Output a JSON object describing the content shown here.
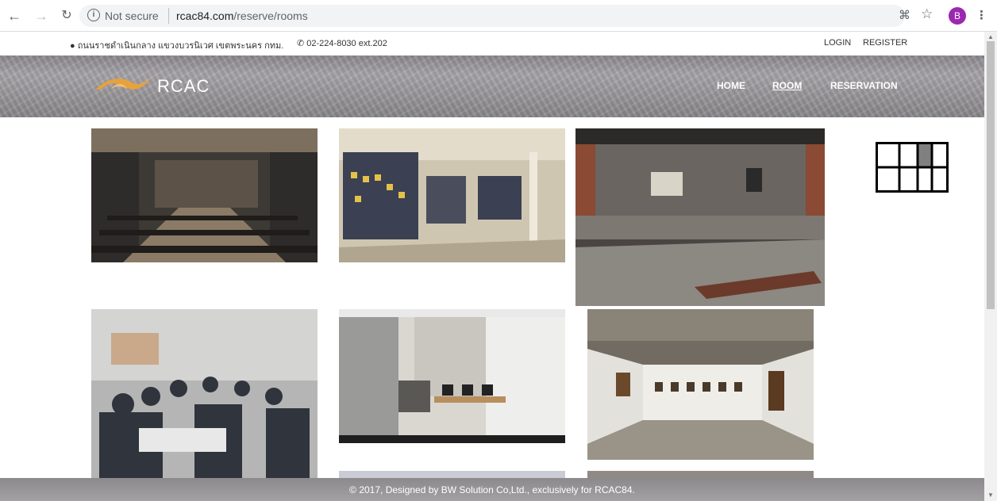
{
  "browser": {
    "security_label": "Not secure",
    "url_host": "rcac84.com",
    "url_path": "/reserve/rooms",
    "avatar_initial": "B"
  },
  "topbar": {
    "address": "ถนนราชดำเนินกลาง แขวงบวรนิเวศ เขตพระนคร กทม.",
    "phone": "02-224-8030 ext.202",
    "login": "LOGIN",
    "register": "REGISTER"
  },
  "header": {
    "brand": "RCAC",
    "menu": [
      {
        "label": "HOME",
        "active": false
      },
      {
        "label": "ROOM",
        "active": true
      },
      {
        "label": "RESERVATION",
        "active": false
      }
    ]
  },
  "gallery": {
    "rooms": [
      {
        "name": "auditorium",
        "colors": [
          "#3d3a35",
          "#8a7a66"
        ]
      },
      {
        "name": "panorama-gallery",
        "colors": [
          "#3b4052",
          "#cfc6b2"
        ]
      },
      {
        "name": "stage-exhibition",
        "colors": [
          "#4a4543",
          "#8c8882"
        ]
      },
      {
        "name": "workshop-room",
        "colors": [
          "#b5b5b5",
          "#30343c"
        ]
      },
      {
        "name": "computer-room",
        "colors": [
          "#9a9a98",
          "#d9d7d0"
        ]
      },
      {
        "name": "white-gallery",
        "colors": [
          "#e3e1dc",
          "#726b61"
        ]
      }
    ]
  },
  "footer": {
    "text": "© 2017, Designed by BW Solution Co,Ltd., exclusively for RCAC84."
  },
  "colors": {
    "header_bg": "#9d9a9e",
    "logo": "#e6a23c",
    "grid_highlight": "#808080"
  }
}
